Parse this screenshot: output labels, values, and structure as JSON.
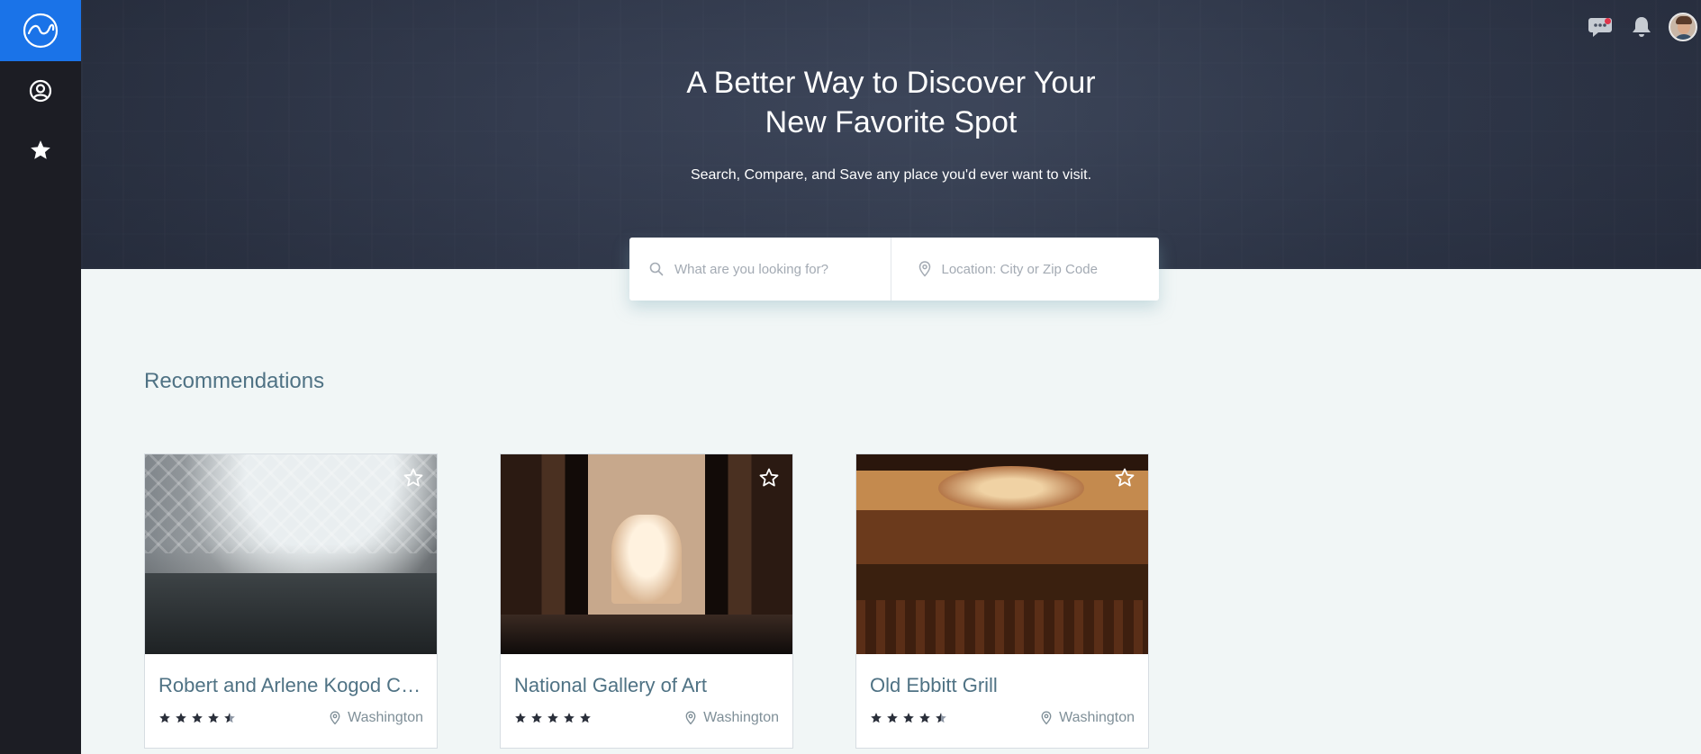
{
  "sidebar": {
    "logo_icon": "wave-logo-icon",
    "items": [
      {
        "name": "profile",
        "icon": "user-circle-icon"
      },
      {
        "name": "favorites",
        "icon": "star-icon"
      }
    ]
  },
  "hero": {
    "title_line1": "A Better Way to Discover Your",
    "title_line2": "New Favorite Spot",
    "subtitle": "Search, Compare, and Save any place you'd ever want to visit."
  },
  "topbar": {
    "icons": [
      "chat-icon",
      "bell-icon",
      "avatar"
    ]
  },
  "search": {
    "query_placeholder": "What are you looking for?",
    "location_placeholder": "Location: City or Zip Code"
  },
  "recommendations": {
    "title": "Recommendations",
    "cards": [
      {
        "name": "Robert and Arlene Kogod C…",
        "location": "Washington",
        "rating": 4.5
      },
      {
        "name": "National Gallery of Art",
        "location": "Washington",
        "rating": 5
      },
      {
        "name": "Old Ebbitt Grill",
        "location": "Washington",
        "rating": 4.5
      }
    ]
  },
  "colors": {
    "sidebar_bg": "#1c1d24",
    "brand_blue": "#1a73e8",
    "accent_text": "#4f7284",
    "page_bg": "#f1f6f6"
  }
}
